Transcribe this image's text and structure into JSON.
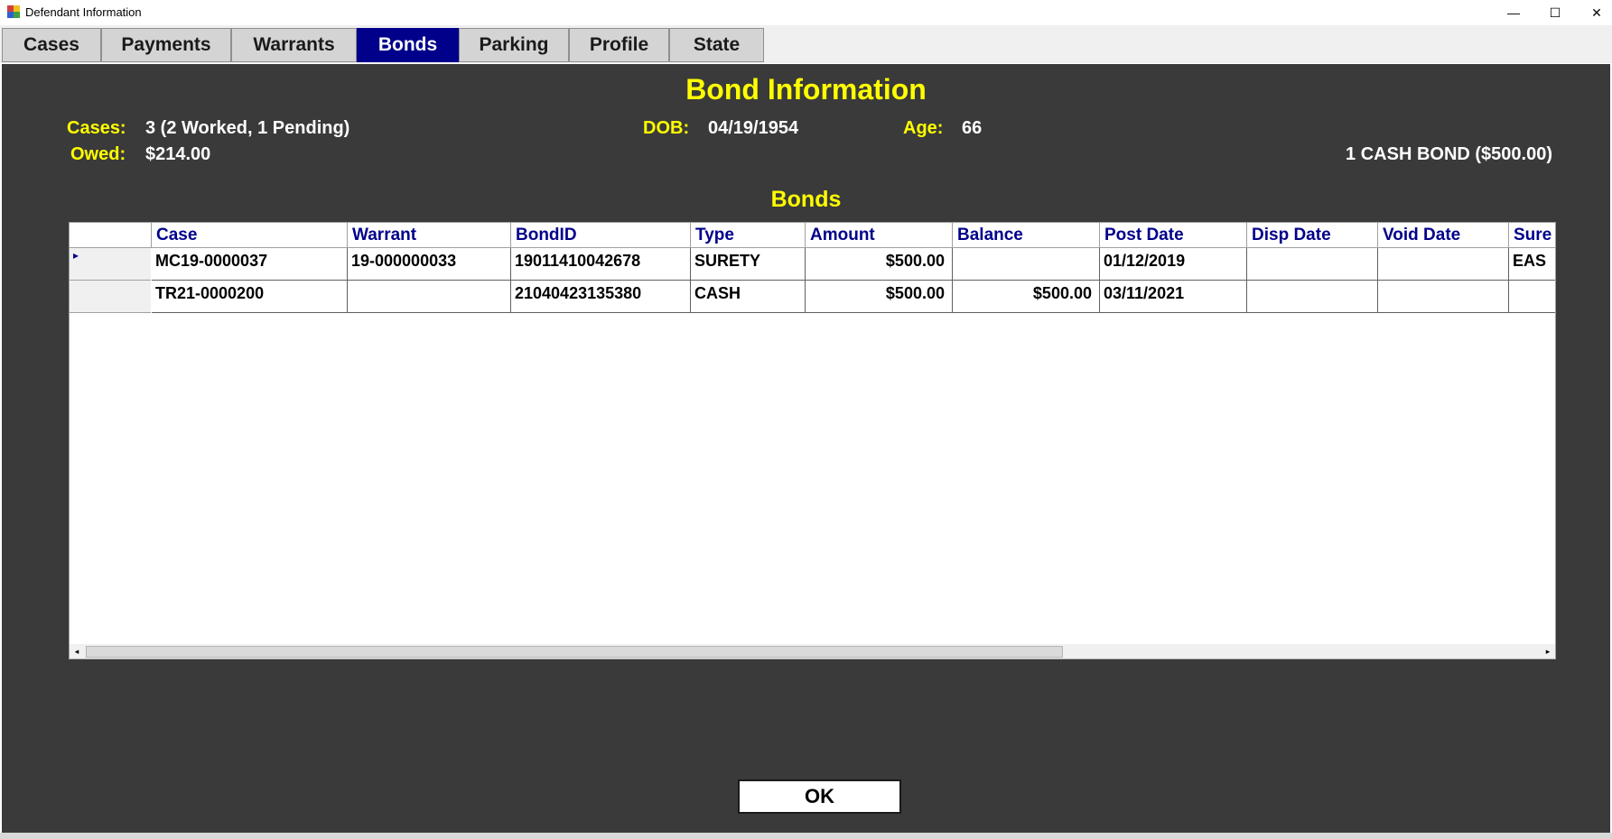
{
  "window": {
    "title": "Defendant Information",
    "minimize": "—",
    "maximize": "☐",
    "close": "✕"
  },
  "tabs": [
    {
      "label": "Cases"
    },
    {
      "label": "Payments"
    },
    {
      "label": "Warrants"
    },
    {
      "label": "Bonds"
    },
    {
      "label": "Parking"
    },
    {
      "label": "Profile"
    },
    {
      "label": "State"
    }
  ],
  "active_tab": "Bonds",
  "header": {
    "title": "Bond Information",
    "cases_label": "Cases:",
    "cases_value": "3 (2 Worked, 1 Pending)",
    "owed_label": "Owed:",
    "owed_value": "$214.00",
    "dob_label": "DOB:",
    "dob_value": "04/19/1954",
    "age_label": "Age:",
    "age_value": "66",
    "bond_summary": "1 CASH BOND ($500.00)"
  },
  "bonds": {
    "title": "Bonds",
    "columns": [
      "Case",
      "Warrant",
      "BondID",
      "Type",
      "Amount",
      "Balance",
      "Post Date",
      "Disp Date",
      "Void Date",
      "Sure"
    ],
    "rows": [
      [
        "MC19-0000037",
        "19-000000033",
        "19011410042678",
        "SURETY",
        "$500.00",
        "",
        "01/12/2019",
        "",
        "",
        "EAS"
      ],
      [
        "TR21-0000200",
        "",
        "21040423135380",
        "CASH",
        "$500.00",
        "$500.00",
        "03/11/2021",
        "",
        "",
        ""
      ]
    ],
    "current_row_marker": "▸"
  },
  "scrollbar": {
    "left_arrow": "◂",
    "right_arrow": "▸"
  },
  "ok_button": "OK",
  "colors": {
    "panel_bg": "#3a3a3a",
    "heading": "#ffff00",
    "active_tab": "#00008b",
    "grid_header_text": "#00008b"
  }
}
